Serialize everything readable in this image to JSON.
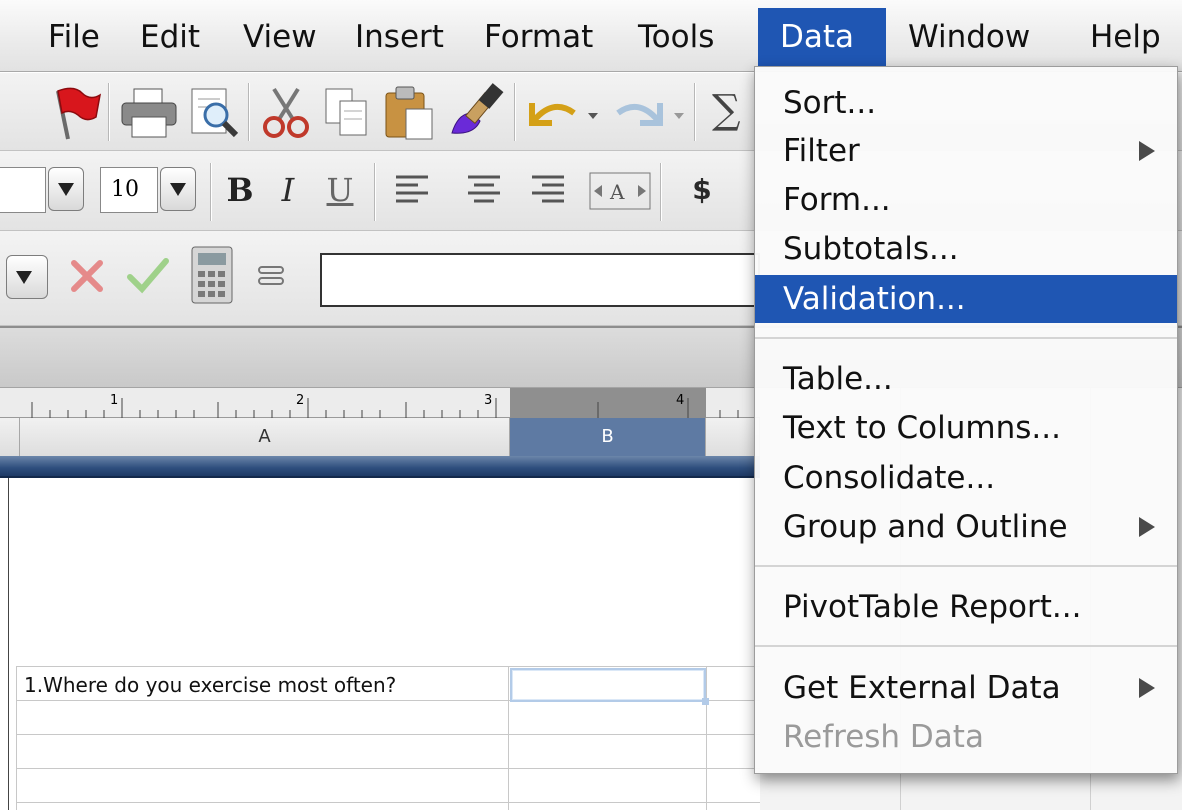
{
  "menubar": {
    "items": [
      "File",
      "Edit",
      "View",
      "Insert",
      "Format",
      "Tools",
      "Data",
      "Window",
      "Help"
    ],
    "active": "Data",
    "active_color": "#1f56b3"
  },
  "toolbar_format": {
    "font_size": "10",
    "bold": "B",
    "italic": "I",
    "underline": "U",
    "currency": "$"
  },
  "toolbar_standard": {
    "autosum": "∑"
  },
  "sheet": {
    "ruler_marks": [
      "1",
      "2",
      "3",
      "4"
    ],
    "columns": [
      "A",
      "B"
    ],
    "selected_column": "B",
    "cells": {
      "A1": "1.Where do you exercise most often?",
      "B1": ""
    }
  },
  "data_menu": {
    "items": [
      {
        "label": "Sort...",
        "submenu": false,
        "enabled": true,
        "highlighted": false
      },
      {
        "label": "Filter",
        "submenu": true,
        "enabled": true,
        "highlighted": false
      },
      {
        "label": "Form...",
        "submenu": false,
        "enabled": true,
        "highlighted": false
      },
      {
        "label": "Subtotals...",
        "submenu": false,
        "enabled": true,
        "highlighted": false
      },
      {
        "label": "Validation...",
        "submenu": false,
        "enabled": true,
        "highlighted": true
      },
      {
        "label": "Table...",
        "submenu": false,
        "enabled": true,
        "highlighted": false
      },
      {
        "label": "Text to Columns...",
        "submenu": false,
        "enabled": true,
        "highlighted": false
      },
      {
        "label": "Consolidate...",
        "submenu": false,
        "enabled": true,
        "highlighted": false
      },
      {
        "label": "Group and Outline",
        "submenu": true,
        "enabled": true,
        "highlighted": false
      },
      {
        "label": "PivotTable Report...",
        "submenu": false,
        "enabled": true,
        "highlighted": false
      },
      {
        "label": "Get External Data",
        "submenu": true,
        "enabled": true,
        "highlighted": false
      },
      {
        "label": "Refresh Data",
        "submenu": false,
        "enabled": false,
        "highlighted": false
      }
    ],
    "highlight_color": "#1f56b3"
  }
}
